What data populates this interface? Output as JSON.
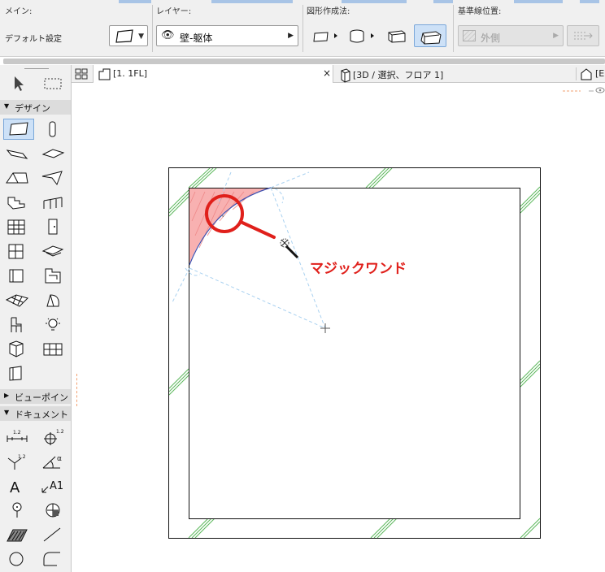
{
  "infobox": {
    "main": {
      "title": "メイン:",
      "default_label": "デフォルト設定"
    },
    "layer": {
      "title": "レイヤー:",
      "value": "壁-躯体"
    },
    "geometry": {
      "title": "図形作成法:"
    },
    "reference": {
      "title": "基準線位置:",
      "value": "外側"
    }
  },
  "toolbox": {
    "sections": [
      {
        "label": "デザイン",
        "expanded": true
      },
      {
        "label": "ビューポイント",
        "expanded": false
      },
      {
        "label": "ドキュメント",
        "expanded": true
      }
    ],
    "doc_labels": {
      "dim": "1.2",
      "level": "1.2",
      "elev": "1.2",
      "angle": "α",
      "text": "A",
      "label": "A1"
    }
  },
  "tabs": [
    {
      "label": "[1. 1FL]",
      "close": "×",
      "active": true
    },
    {
      "label": "[3D / 選択、フロア 1]",
      "active": false
    },
    {
      "label": "[E",
      "active": false
    }
  ],
  "annotation": {
    "text": "マジックワンド"
  },
  "colors": {
    "accent": "#e0201b",
    "selection": "#cde1f7",
    "fill_highlight": "#f7a8a8",
    "guide": "#a9d1f0",
    "wall_hatch": "#5cb85c"
  }
}
